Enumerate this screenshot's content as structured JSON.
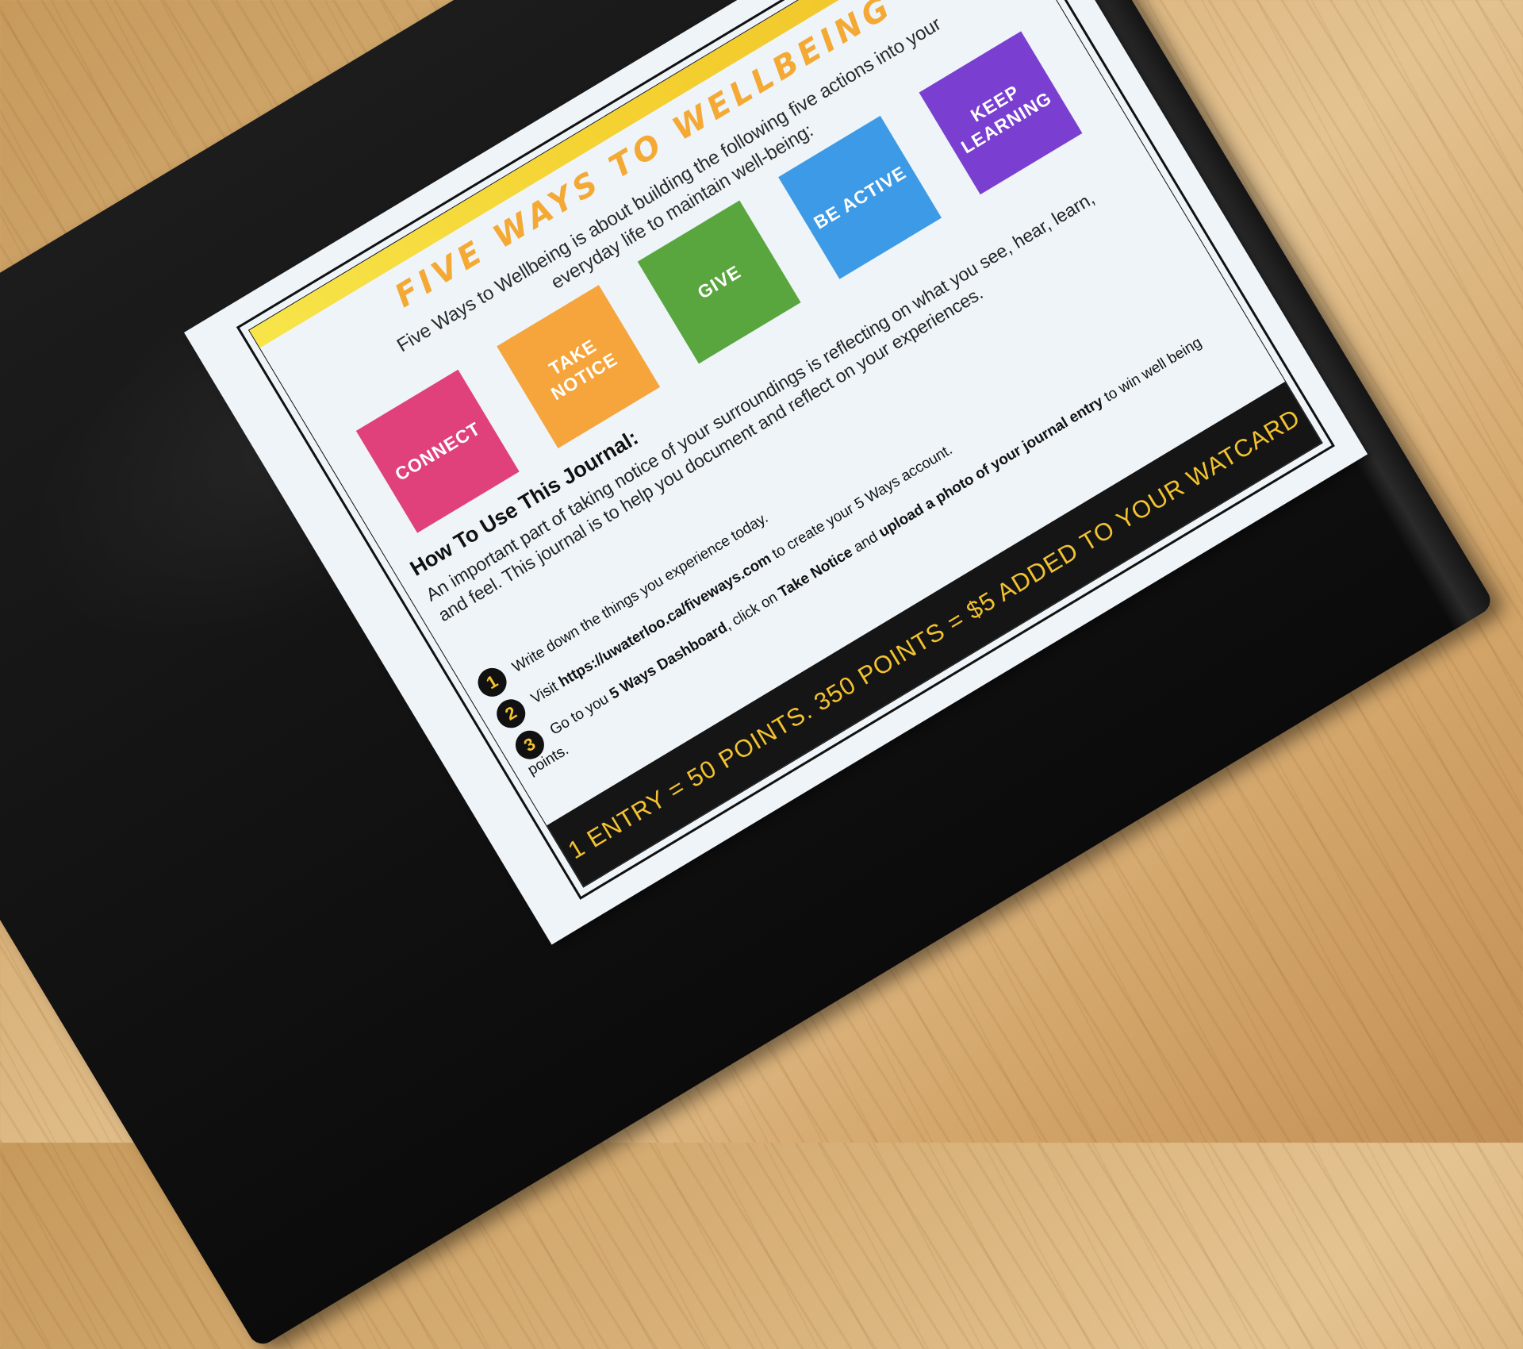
{
  "flyer": {
    "title": "FIVE WAYS TO WELLBEING",
    "intro": "Five Ways to Wellbeing is about building the following five actions into your everyday life to maintain well-being:",
    "tiles": [
      {
        "label": "CONNECT",
        "color": "#e0417a"
      },
      {
        "label": "TAKE\nNOTICE",
        "color": "#f5a53b"
      },
      {
        "label": "GIVE",
        "color": "#5aa63e"
      },
      {
        "label": "BE ACTIVE",
        "color": "#3d9ae6"
      },
      {
        "label": "KEEP\nLEARNING",
        "color": "#7a3fd0"
      }
    ],
    "howto_heading": "How To Use This Journal:",
    "howto_body": "An important part of taking notice of your surroundings is reflecting on what you see, hear, learn, and feel. This journal is to help you document and reflect on your experiences.",
    "steps": [
      {
        "number": "1",
        "text": "Write down the things you experience today."
      },
      {
        "number": "2",
        "pre": "Visit ",
        "bold": "https://uwaterloo.ca/fiveways.com",
        "post": " to create your 5 Ways account."
      },
      {
        "number": "3",
        "pre": "Go to you ",
        "bold": "5 Ways Dashboard",
        "mid": ", click on ",
        "bold2": "Take Notice",
        "mid2": " and ",
        "bold3": "upload a photo of your journal entry",
        "post": " to win well being points."
      }
    ],
    "banner": "1 ENTRY = 50 POINTS. 350 POINTS = $5 ADDED TO YOUR WATCARD",
    "accent_yellow": "#f4c430"
  }
}
